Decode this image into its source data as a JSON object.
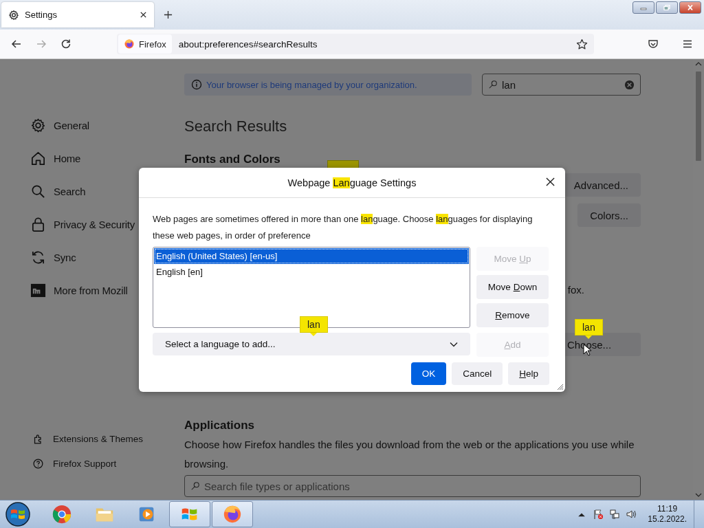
{
  "tabs": [
    {
      "title": "Settings",
      "selected": true
    }
  ],
  "toolbar": {
    "identity": "Firefox",
    "url": "about:preferences#searchResults"
  },
  "notice": "Your browser is being managed by your organization.",
  "search": {
    "value": "lan"
  },
  "sidebar": {
    "items": [
      {
        "label": "General"
      },
      {
        "label": "Home"
      },
      {
        "label": "Search"
      },
      {
        "label": "Privacy & Security"
      },
      {
        "label": "Sync"
      },
      {
        "label": "More from Mozill"
      }
    ],
    "footer": [
      {
        "label": "Extensions & Themes"
      },
      {
        "label": "Firefox Support"
      }
    ]
  },
  "content": {
    "heading": "Search Results",
    "section": "Fonts and Colors",
    "advanced_button": "Advanced...",
    "colors_button": "Colors...",
    "text_fragment": "fox.",
    "choose_badge": "lan",
    "choose_button": "Choose...",
    "applications": {
      "heading": "Applications",
      "description": "Choose how Firefox handles the files you download from the web or the applications you use while browsing.",
      "search_placeholder": "Search file types or applications"
    }
  },
  "dialog": {
    "title": [
      {
        "text": "Webpage "
      },
      {
        "text": "Lan",
        "highlighted": true
      },
      {
        "text": "guage Settings"
      }
    ],
    "description": [
      {
        "text": "Web pages are sometimes offered in more than one "
      },
      {
        "text": "lan",
        "highlighted": true
      },
      {
        "text": "guage. Choose "
      },
      {
        "text": "lan",
        "highlighted": true
      },
      {
        "text": "guages for displaying these web pages, in order of preference"
      }
    ],
    "languages": [
      {
        "label": "English (United States) [en-us]",
        "selected": true
      },
      {
        "label": "English [en]",
        "selected": false
      }
    ],
    "side_buttons": [
      {
        "label": [
          {
            "text": "Move "
          },
          {
            "text": "U",
            "underlined": true
          },
          {
            "text": "p"
          }
        ],
        "disabled": true
      },
      {
        "label": [
          {
            "text": "Move "
          },
          {
            "text": "D",
            "underlined": true
          },
          {
            "text": "own"
          }
        ],
        "disabled": false
      },
      {
        "label": [
          {
            "text": "R",
            "underlined": true
          },
          {
            "text": "emove"
          }
        ],
        "disabled": false
      }
    ],
    "select_placeholder": "Select a language to add...",
    "add_button": {
      "label": [
        {
          "text": "A",
          "underlined": true
        },
        {
          "text": "dd"
        }
      ],
      "disabled": true
    },
    "tooltip": "lan",
    "footer_buttons": [
      {
        "label": [
          {
            "text": "OK"
          }
        ],
        "kind": "primary"
      },
      {
        "label": [
          {
            "text": "Cancel"
          }
        ],
        "kind": "normal"
      },
      {
        "label": [
          {
            "text": "H",
            "underlined": true
          },
          {
            "text": "elp"
          }
        ],
        "kind": "normal"
      }
    ]
  },
  "taskbar": {
    "apps": [
      {
        "open": false
      },
      {
        "open": false
      },
      {
        "open": false
      },
      {
        "open": true
      },
      {
        "open": true
      }
    ],
    "time": "11:19",
    "date": "15.2.2022."
  }
}
